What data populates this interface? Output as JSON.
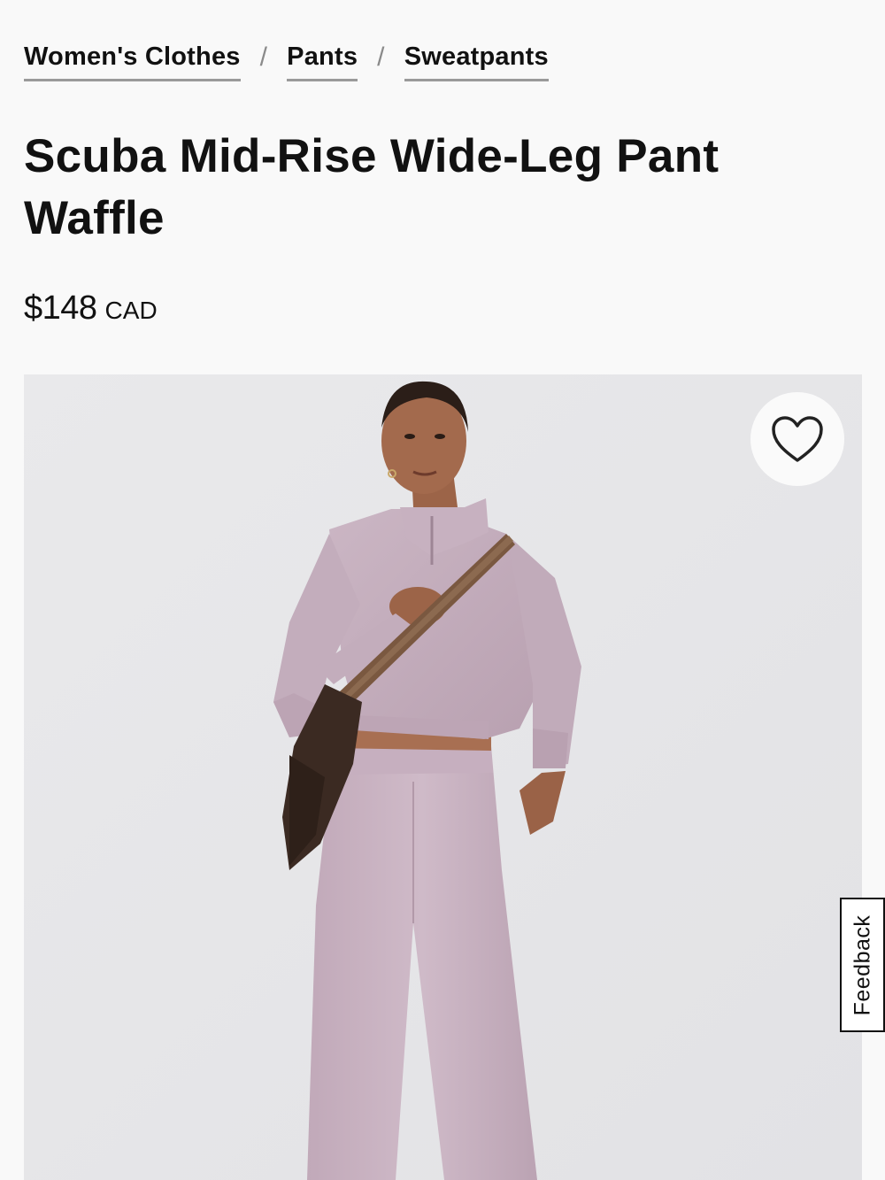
{
  "breadcrumb": {
    "items": [
      {
        "label": "Women's Clothes"
      },
      {
        "label": "Pants"
      },
      {
        "label": "Sweatpants"
      }
    ],
    "separator": "/"
  },
  "product": {
    "title_line1": "Scuba Mid-Rise Wide-Leg Pant",
    "title_line2": "Waffle",
    "price": "$148",
    "currency": "CAD"
  },
  "gallery": {
    "wishlist_icon": "heart-outline-icon"
  },
  "feedback": {
    "label": "Feedback"
  },
  "colors": {
    "background": "#f9f9f9",
    "text": "#111111",
    "photo_background": "#e6e6e8",
    "garment": "#c9b3c2",
    "bag": "#3b2a22"
  }
}
